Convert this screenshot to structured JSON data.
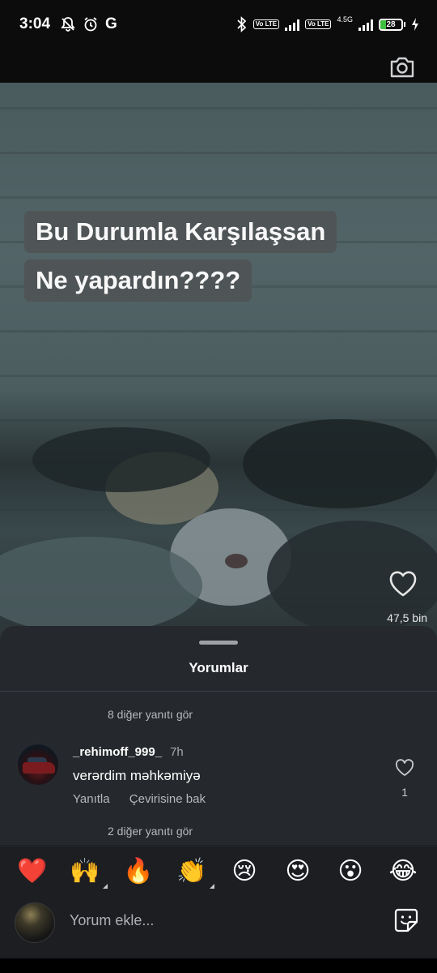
{
  "status_bar": {
    "time": "3:04",
    "battery": "28",
    "battery_fraction": 0.28,
    "network_label": "4.5G",
    "volte_label": "Vo LTE",
    "g_label": "G"
  },
  "video": {
    "caption_line1": "Bu Durumla Karşılaşsan",
    "caption_line2": "Ne yapardın????",
    "like_count": "47,5 bin"
  },
  "comments": {
    "title": "Yorumlar",
    "more_replies_top": "8 diğer yanıtı gör",
    "comment": {
      "username": "_rehimoff_999_",
      "time": "7h",
      "text": "verərdim məhkəmiyə",
      "reply_label": "Yanıtla",
      "translate_label": "Çevirisine bak",
      "like_count": "1"
    },
    "more_replies_bottom": "2 diğer yanıtı gör"
  },
  "emoji_bar": {
    "items": [
      {
        "glyph": "❤️",
        "name": "red-heart-emoji"
      },
      {
        "glyph": "🙌",
        "name": "raising-hands-emoji"
      },
      {
        "glyph": "🔥",
        "name": "fire-emoji"
      },
      {
        "glyph": "👏",
        "name": "clapping-hands-emoji"
      },
      {
        "glyph": "😢",
        "name": "crying-face-emoji"
      },
      {
        "glyph": "😍",
        "name": "heart-eyes-emoji"
      },
      {
        "glyph": "😮",
        "name": "surprised-face-emoji"
      },
      {
        "glyph": "😂",
        "name": "tears-of-joy-emoji"
      }
    ]
  },
  "input": {
    "placeholder": "Yorum ekle..."
  },
  "colors": {
    "sheet_bg": "#25282d",
    "muted_text": "#b6b9bd",
    "battery_green": "#3fbf3f"
  }
}
